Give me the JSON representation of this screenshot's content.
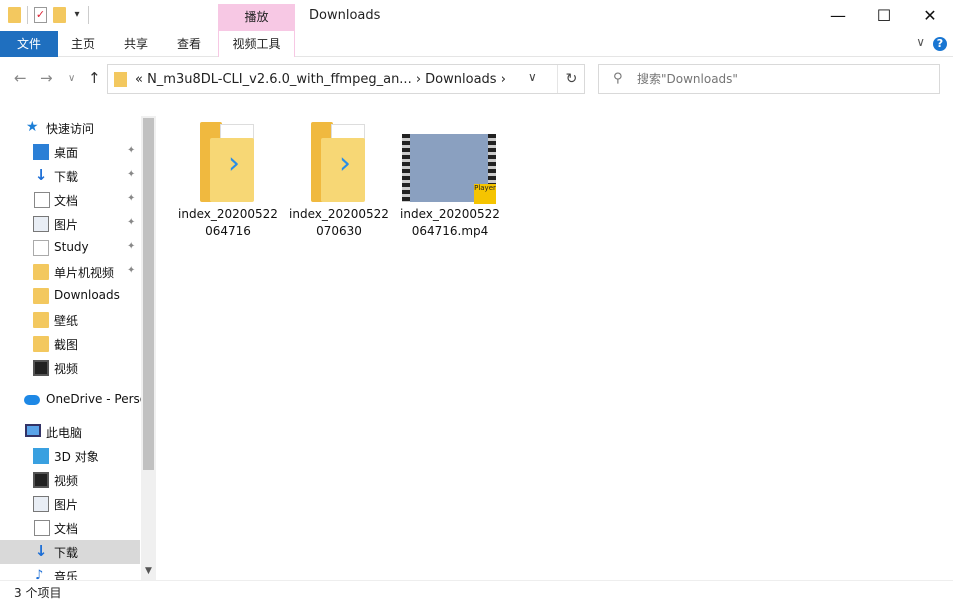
{
  "titlebar": {
    "context_tab": "播放",
    "title": "Downloads",
    "minimize": "—",
    "maximize": "☐",
    "close": "✕"
  },
  "ribbon": {
    "tabs": [
      "文件",
      "主页",
      "共享",
      "查看",
      "视频工具"
    ],
    "help": "?",
    "collapse": "∨"
  },
  "address": {
    "crumbs": "«   N_m3u8DL-CLI_v2.6.0_with_ffmpeg_an...   ›   Downloads   ›",
    "back": "←",
    "forward": "→",
    "recent": "∨",
    "up": "↑",
    "dropdown": "∨",
    "refresh": "↻"
  },
  "search": {
    "placeholder": "搜索\"Downloads\""
  },
  "nav": {
    "quick_access": "快速访问",
    "items": [
      {
        "label": "桌面",
        "pinned": true,
        "icon": "desktop-icon"
      },
      {
        "label": "下载",
        "pinned": true,
        "icon": "download-icon"
      },
      {
        "label": "文档",
        "pinned": true,
        "icon": "document-icon"
      },
      {
        "label": "图片",
        "pinned": true,
        "icon": "picture-icon"
      },
      {
        "label": "Study",
        "pinned": true,
        "icon": "folder-icon"
      },
      {
        "label": "单片机视频",
        "pinned": true,
        "icon": "folder-icon"
      },
      {
        "label": "Downloads",
        "pinned": false,
        "icon": "folder-icon"
      },
      {
        "label": "壁纸",
        "pinned": false,
        "icon": "folder-icon"
      },
      {
        "label": "截图",
        "pinned": false,
        "icon": "folder-icon"
      },
      {
        "label": "视频",
        "pinned": false,
        "icon": "video-icon"
      }
    ],
    "onedrive": "OneDrive - Perso",
    "this_pc": "此电脑",
    "pc_items": [
      {
        "label": "3D 对象",
        "icon": "3d-objects-icon"
      },
      {
        "label": "视频",
        "icon": "video-icon"
      },
      {
        "label": "图片",
        "icon": "picture-icon"
      },
      {
        "label": "文档",
        "icon": "document-icon"
      },
      {
        "label": "下载",
        "icon": "download-icon"
      },
      {
        "label": "音乐",
        "icon": "music-icon"
      }
    ],
    "pin_glyph": "📌"
  },
  "files": [
    {
      "name": "index_20200522064716",
      "type": "folder"
    },
    {
      "name": "index_20200522070630",
      "type": "folder"
    },
    {
      "name": "index_20200522064716.mp4",
      "type": "video",
      "badge": "Player"
    }
  ],
  "status": {
    "count": "3 个项目"
  }
}
